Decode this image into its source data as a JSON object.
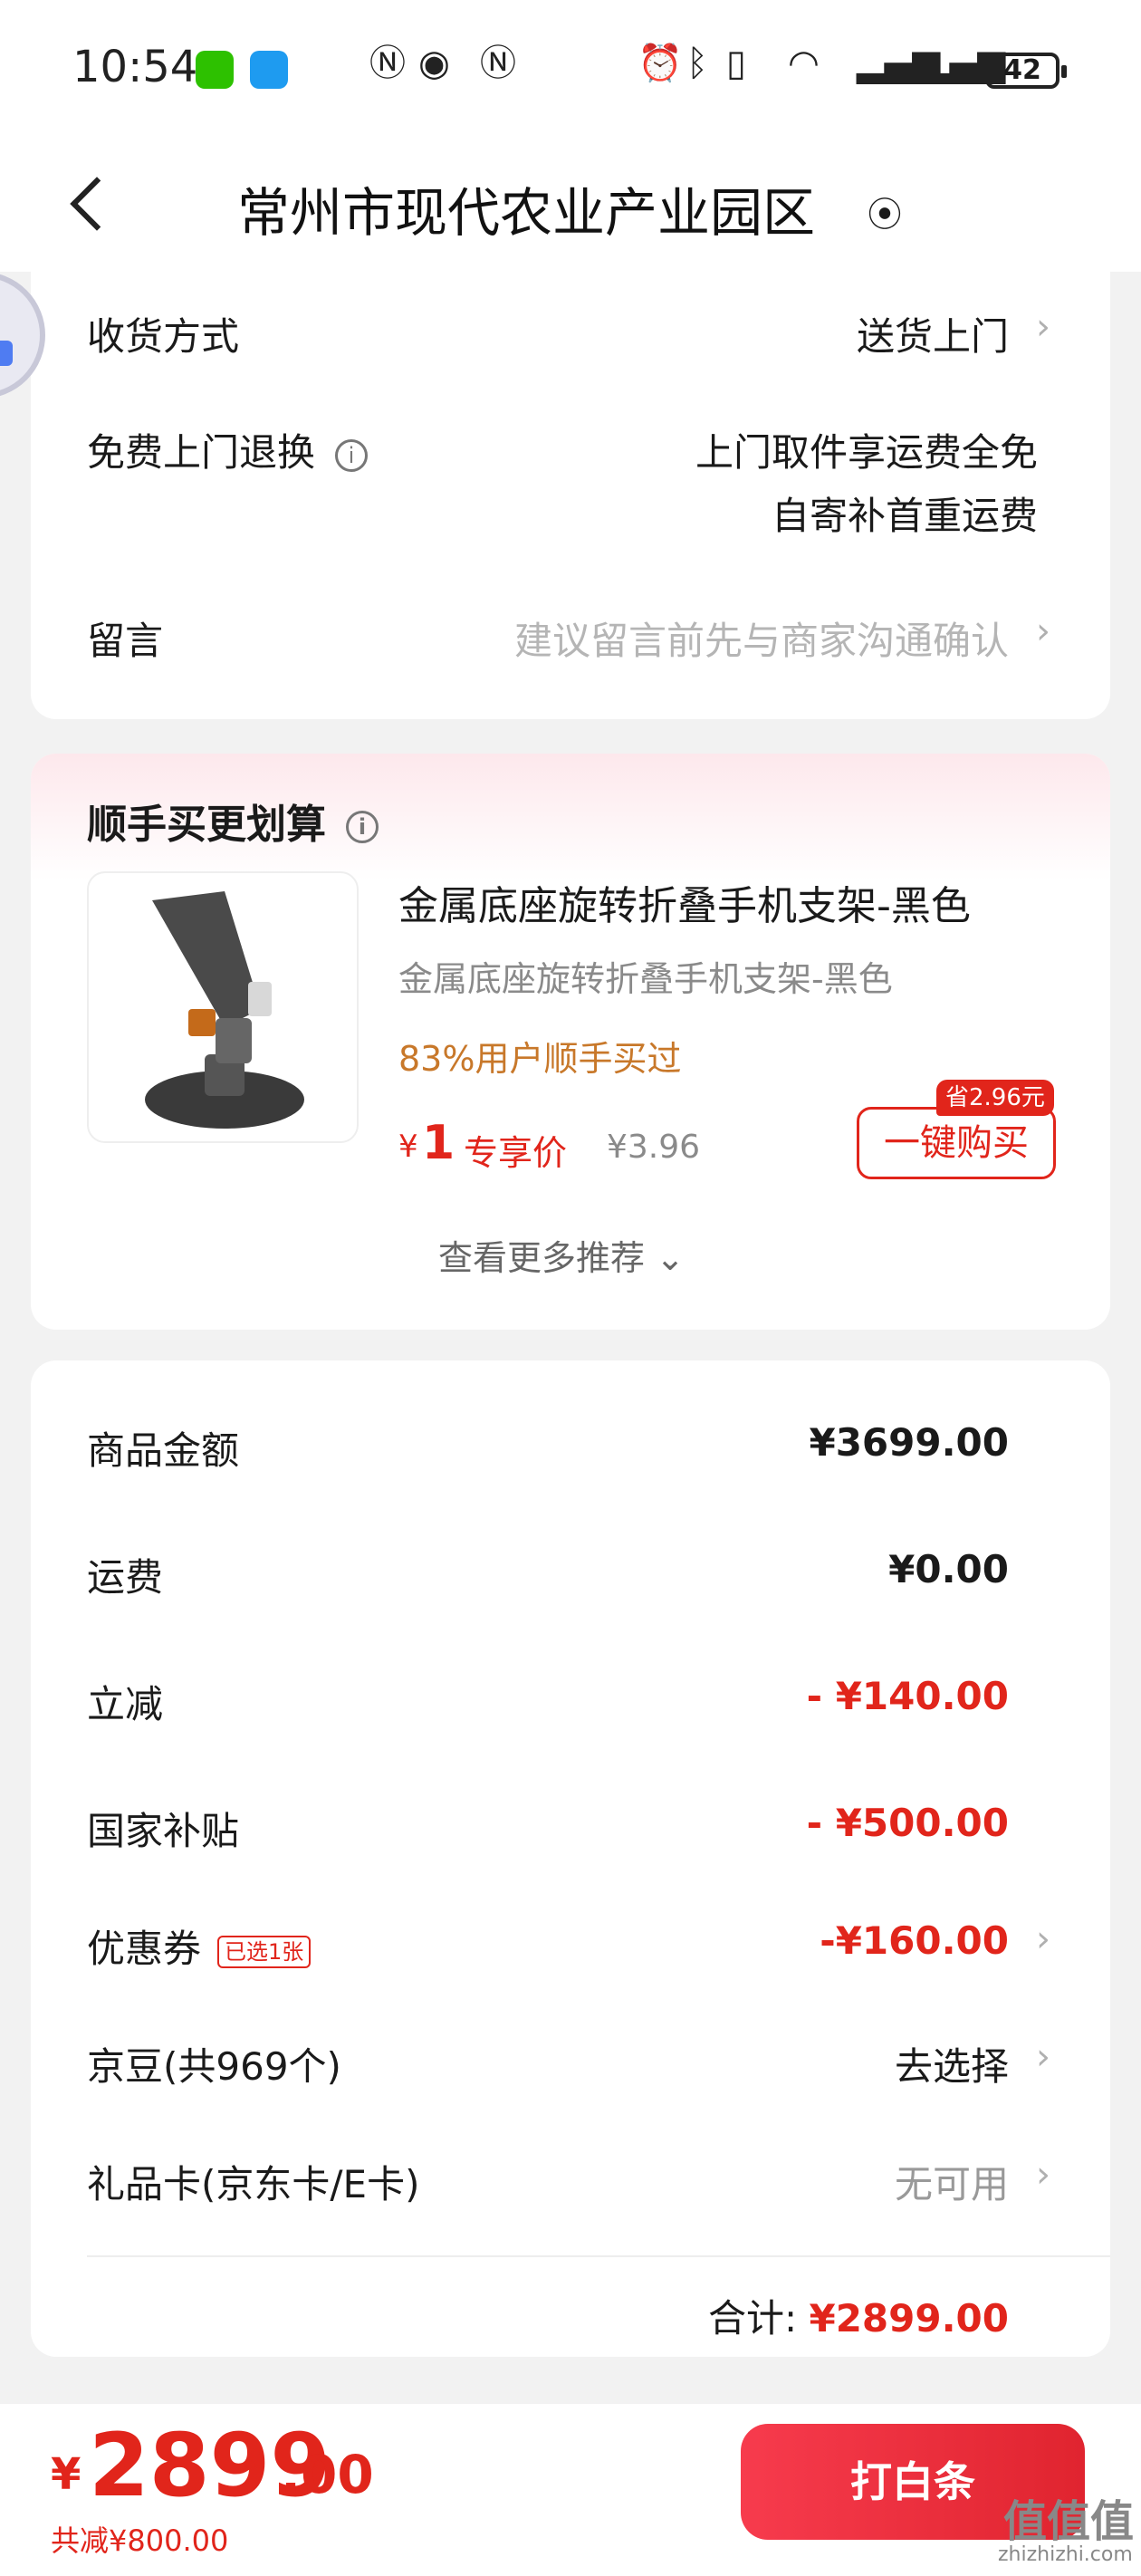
{
  "status_bar": {
    "time": "10:54",
    "battery": "42"
  },
  "nav": {
    "title": "常州市现代农业产业园区"
  },
  "delivery": {
    "method_label": "收货方式",
    "method_value": "送货上门",
    "return_label": "免费上门退换",
    "return_line1": "上门取件享运费全免",
    "return_line2": "自寄补首重运费",
    "message_label": "留言",
    "message_placeholder": "建议留言前先与商家沟通确认"
  },
  "promo": {
    "title": "顺手买更划算",
    "product_name": "金属底座旋转折叠手机支架-黑色",
    "product_spec": "金属底座旋转折叠手机支架-黑色",
    "social_proof": "83%用户顺手买过",
    "price_symbol": "¥",
    "price": "1",
    "price_tag": "专享价",
    "original_price": "¥3.96",
    "save_tag": "省2.96元",
    "buy_button": "一键购买",
    "more": "查看更多推荐"
  },
  "summary": {
    "goods_label": "商品金额",
    "goods_value": "¥3699.00",
    "shipping_label": "运费",
    "shipping_value": "¥0.00",
    "discount_label": "立减",
    "discount_value": "- ¥140.00",
    "subsidy_label": "国家补贴",
    "subsidy_value": "- ¥500.00",
    "coupon_label": "优惠券",
    "coupon_tag": "已选1张",
    "coupon_value": "-¥160.00",
    "beans_label": "京豆(共969个)",
    "beans_value": "去选择",
    "giftcard_label": "礼品卡(京东卡/E卡)",
    "giftcard_value": "无可用",
    "total_label": "合计:",
    "total_value": "¥2899.00"
  },
  "bottom": {
    "yen": "¥",
    "amount_int": "2899",
    "amount_dec": ".00",
    "saved": "共减¥800.00",
    "pay_button": "打白条"
  },
  "watermark": {
    "main": "值值值",
    "sub": "zhizhizhi.com"
  }
}
